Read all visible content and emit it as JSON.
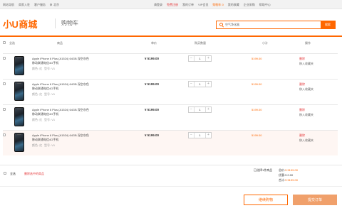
{
  "topbar": {
    "left": [
      "网站导航",
      "商家入驻",
      "客户服务"
    ],
    "location": "北京",
    "right": [
      {
        "label": "请登录",
        "style": ""
      },
      {
        "label": "免费注册",
        "style": "red"
      },
      {
        "label": "我的订单",
        "style": ""
      },
      {
        "label": "VIP会员",
        "style": ""
      },
      {
        "label": "购物车 0",
        "style": "orange"
      },
      {
        "label": "我的收藏",
        "style": ""
      },
      {
        "label": "企业采购",
        "style": ""
      },
      {
        "label": "帮助中心",
        "style": ""
      }
    ]
  },
  "header": {
    "logo_u": "小U",
    "logo_text": "商城",
    "page_name": "购物车",
    "search_value": "空气净化器",
    "search_button": "搜索"
  },
  "table": {
    "headers": {
      "select_all": "全选",
      "product": "商品",
      "price": "单价",
      "quantity": "购买数量",
      "subtotal": "小计",
      "actions": "操作"
    },
    "rows": [
      {
        "name": "Apple iPhone 6 Plus (A1524) 64GB 深空灰色",
        "name2": "移动联通电信4G手机",
        "color": "颜色: 红",
        "size": "型号: V1",
        "price": "¥ 5199.00",
        "qty": "1",
        "subtotal": "5199.00",
        "delete": "删除",
        "favorite": "移入收藏夹",
        "highlight": false
      },
      {
        "name": "Apple iPhone 6 Plus (A1524) 64GB 深空灰色",
        "name2": "移动联通电信4G手机",
        "color": "颜色: 红",
        "size": "型号: V1",
        "price": "¥ 5199.00",
        "qty": "1",
        "subtotal": "5199.00",
        "delete": "删除",
        "favorite": "移入收藏夹",
        "highlight": false
      },
      {
        "name": "Apple iPhone 6 Plus (A1524) 64GB 深空灰色",
        "name2": "移动联通电信4G手机",
        "color": "颜色: 红",
        "size": "型号: V1",
        "price": "¥ 5199.00",
        "qty": "1",
        "subtotal": "5199.00",
        "delete": "删除",
        "favorite": "移入收藏夹",
        "highlight": false
      },
      {
        "name": "Apple iPhone 6 Plus (A1524) 64GB 深空灰色",
        "name2": "移动联通电信4G手机",
        "color": "颜色: 红",
        "size": "型号: V1",
        "price": "¥ 5199.00",
        "qty": "1",
        "subtotal": "5199.00",
        "delete": "删除",
        "favorite": "移入收藏夹",
        "highlight": true
      }
    ]
  },
  "footer": {
    "select_all": "全选",
    "delete_selected": "删除选中的商品",
    "selected_count": "已选择1件商品",
    "total_label": "总价:",
    "total_value": "¥ 5199.00",
    "discount_label": "优惠:",
    "discount_value": "¥ 0.00",
    "payable_label": "合计:",
    "payable_value": "¥ 5199.00"
  },
  "buttons": {
    "continue": "继续购物",
    "submit": "提交订单"
  },
  "colors": {
    "accent": "#ff6700",
    "danger": "#e4393c",
    "submit": "#f0a06b"
  }
}
